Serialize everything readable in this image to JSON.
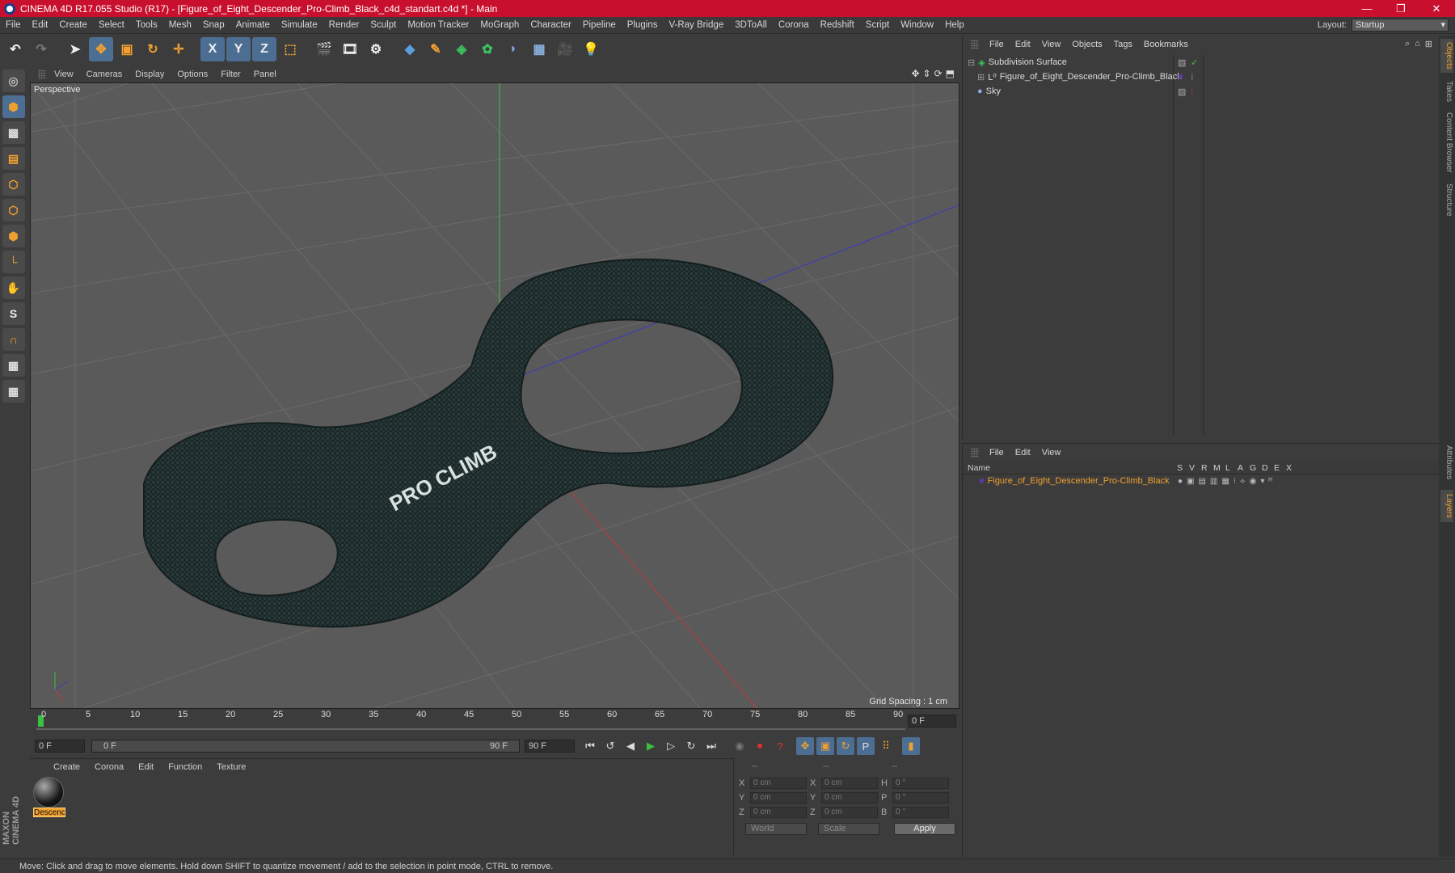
{
  "window": {
    "title": "CINEMA 4D R17.055 Studio (R17) - [Figure_of_Eight_Descender_Pro-Climb_Black_c4d_standart.c4d *] - Main",
    "minimize": "—",
    "maximize": "❐",
    "close": "✕"
  },
  "menu": {
    "items": [
      "File",
      "Edit",
      "Create",
      "Select",
      "Tools",
      "Mesh",
      "Snap",
      "Animate",
      "Simulate",
      "Render",
      "Sculpt",
      "Motion Tracker",
      "MoGraph",
      "Character",
      "Pipeline",
      "Plugins",
      "V-Ray Bridge",
      "3DToAll",
      "Corona",
      "Redshift",
      "Script",
      "Window",
      "Help"
    ],
    "layout_label": "Layout:",
    "layout_value": "Startup"
  },
  "toolbar": {
    "axis_x": "X",
    "axis_y": "Y",
    "axis_z": "Z"
  },
  "viewport": {
    "menu": [
      "View",
      "Cameras",
      "Display",
      "Options",
      "Filter",
      "Panel"
    ],
    "label": "Perspective",
    "grid_spacing": "Grid Spacing : 1 cm",
    "brand_text": "PRO CLIMB",
    "accent_grid": "#6a6a6a",
    "object_color": "#1f2e2e"
  },
  "timeline": {
    "ticks": [
      "0",
      "5",
      "10",
      "15",
      "20",
      "25",
      "30",
      "35",
      "40",
      "45",
      "50",
      "55",
      "60",
      "65",
      "70",
      "75",
      "80",
      "85",
      "90"
    ],
    "current_frame": "0 F"
  },
  "playback": {
    "start": "0 F",
    "range_start": "0 F",
    "range_end": "90 F",
    "end": "90 F"
  },
  "material_manager": {
    "menu": [
      "Create",
      "Corona",
      "Edit",
      "Function",
      "Texture"
    ],
    "material_name": "Descenc"
  },
  "coordinates": {
    "col1": "--",
    "col2": "--",
    "col3": "--",
    "pos_labels": [
      "X",
      "Y",
      "Z"
    ],
    "size_labels": [
      "X",
      "Y",
      "Z"
    ],
    "rot_labels": [
      "H",
      "P",
      "B"
    ],
    "pos_values": [
      "0 cm",
      "0 cm",
      "0 cm"
    ],
    "size_values": [
      "0 cm",
      "0 cm",
      "0 cm"
    ],
    "rot_values": [
      "0 °",
      "0 °",
      "0 °"
    ],
    "mode1": "World",
    "mode2": "Scale",
    "apply": "Apply"
  },
  "status": {
    "text": "Move: Click and drag to move elements. Hold down SHIFT to quantize movement / add to the selection in point mode, CTRL to remove."
  },
  "object_manager": {
    "menu": [
      "File",
      "Edit",
      "View",
      "Objects",
      "Tags",
      "Bookmarks"
    ],
    "objects": [
      "Subdivision Surface",
      "Figure_of_Eight_Descender_Pro-Climb_Black",
      "Sky"
    ]
  },
  "layer_manager": {
    "menu": [
      "File",
      "Edit",
      "View"
    ],
    "header_name": "Name",
    "columns": [
      "S",
      "V",
      "R",
      "M",
      "L",
      "A",
      "G",
      "D",
      "E",
      "X"
    ],
    "layer_name": "Figure_of_Eight_Descender_Pro-Climb_Black",
    "layer_color": "#f0a030"
  },
  "side_tabs": [
    "Objects",
    "Takes",
    "Content Browser",
    "Structure",
    "Attributes",
    "Layers"
  ],
  "maxon_logo": "MAXON CINEMA 4D"
}
